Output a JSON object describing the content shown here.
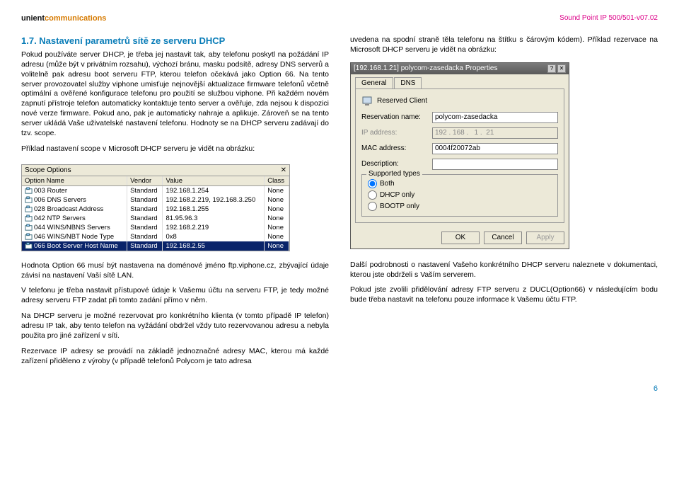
{
  "header": {
    "brand_prefix": "unient",
    "brand_suffix": "communications",
    "doc_version": "Sound Point IP 500/501-v07.02"
  },
  "left": {
    "section_title": "1.7. Nastavení parametrů sítě ze serveru DHCP",
    "p1": "Pokud používáte server DHCP, je třeba jej nastavit tak, aby telefonu poskytl na požádání IP adresu (může být v privátním rozsahu), výchozí bránu, masku podsítě, adresy DNS serverů a volitelně pak adresu boot serveru FTP, kterou telefon očekává jako Option 66. Na tento server provozovatel služby viphone umisťuje nejnovější aktualizace firmware telefonů včetně optimální a ověřené konfigurace telefonu pro použití se službou viphone. Při každém novém zapnutí přístroje telefon automaticky kontaktuje tento server a ověřuje, zda nejsou k dispozici nové verze firmware. Pokud ano, pak je automaticky nahraje a aplikuje. Zároveň se na tento server ukládá Vaše uživatelské nastavení telefonu. Hodnoty se na DHCP serveru zadávají do tzv. scope.",
    "p2": "Příklad nastavení scope v Microsoft DHCP serveru je vidět na obrázku:",
    "scope": {
      "window_title": "Scope Options",
      "headers": [
        "Option Name",
        "Vendor",
        "Value",
        "Class"
      ],
      "rows": [
        {
          "name": "003 Router",
          "vendor": "Standard",
          "value": "192.168.1.254",
          "class": "None"
        },
        {
          "name": "006 DNS Servers",
          "vendor": "Standard",
          "value": "192.168.2.219, 192.168.3.250",
          "class": "None"
        },
        {
          "name": "028 Broadcast Address",
          "vendor": "Standard",
          "value": "192.168.1.255",
          "class": "None"
        },
        {
          "name": "042 NTP Servers",
          "vendor": "Standard",
          "value": "81.95.96.3",
          "class": "None"
        },
        {
          "name": "044 WINS/NBNS Servers",
          "vendor": "Standard",
          "value": "192.168.2.219",
          "class": "None"
        },
        {
          "name": "046 WINS/NBT Node Type",
          "vendor": "Standard",
          "value": "0x8",
          "class": "None"
        },
        {
          "name": "066 Boot Server Host Name",
          "vendor": "Standard",
          "value": "192.168.2.55",
          "class": "None",
          "selected": true
        }
      ]
    },
    "p3": "Hodnota Option 66 musí být nastavena na doménové jméno ftp.viphone.cz, zbývající údaje závisí na nastavení Vaší sítě LAN.",
    "p4": "V telefonu je třeba nastavit přístupové údaje k Vašemu účtu na serveru FTP, je tedy možné adresy serveru FTP zadat při tomto zadání přímo v něm.",
    "p5": "Na DHCP serveru je možné rezervovat pro konkrétního klienta (v tomto případě IP telefon) adresu IP tak, aby tento telefon na vyžádání obdržel vždy tuto rezervovanou adresu a nebyla použita pro jiné zařízení v síti.",
    "p6": "Rezervace IP adresy se provádí na základě jednoznačné adresy MAC, kterou má každé zařízení přiděleno z výroby (v případě telefonů Polycom je tato adresa"
  },
  "right": {
    "p1": "uvedena na spodní straně těla telefonu na štítku s čárovým kódem). Příklad rezervace na Microsoft DHCP serveru je vidět na obrázku:",
    "props": {
      "title": "[192.168.1.21] polycom-zasedacka Properties",
      "tabs": {
        "general": "General",
        "dns": "DNS"
      },
      "reserved_client_label": "Reserved Client",
      "fields": {
        "reservation_name_label": "Reservation name:",
        "reservation_name_value": "polycom-zasedacka",
        "ip_label": "IP address:",
        "ip_value": "192 . 168 .   1 .  21",
        "mac_label": "MAC address:",
        "mac_value": "0004f20072ab",
        "description_label": "Description:",
        "description_value": ""
      },
      "supported_types": {
        "legend": "Supported types",
        "both": "Both",
        "dhcp_only": "DHCP only",
        "bootp_only": "BOOTP only",
        "selected": "both"
      },
      "buttons": {
        "ok": "OK",
        "cancel": "Cancel",
        "apply": "Apply"
      }
    },
    "p2": "Další podrobnosti o nastavení Vašeho konkrétního DHCP serveru naleznete v dokumentaci, kterou jste obdrželi s Vaším serverem.",
    "p3": "Pokud jste zvolili přidělování adresy FTP serveru z DUCL(Option66) v následujícím bodu bude třeba nastavit na telefonu pouze informace k Vašemu účtu FTP."
  },
  "page_number": "6"
}
